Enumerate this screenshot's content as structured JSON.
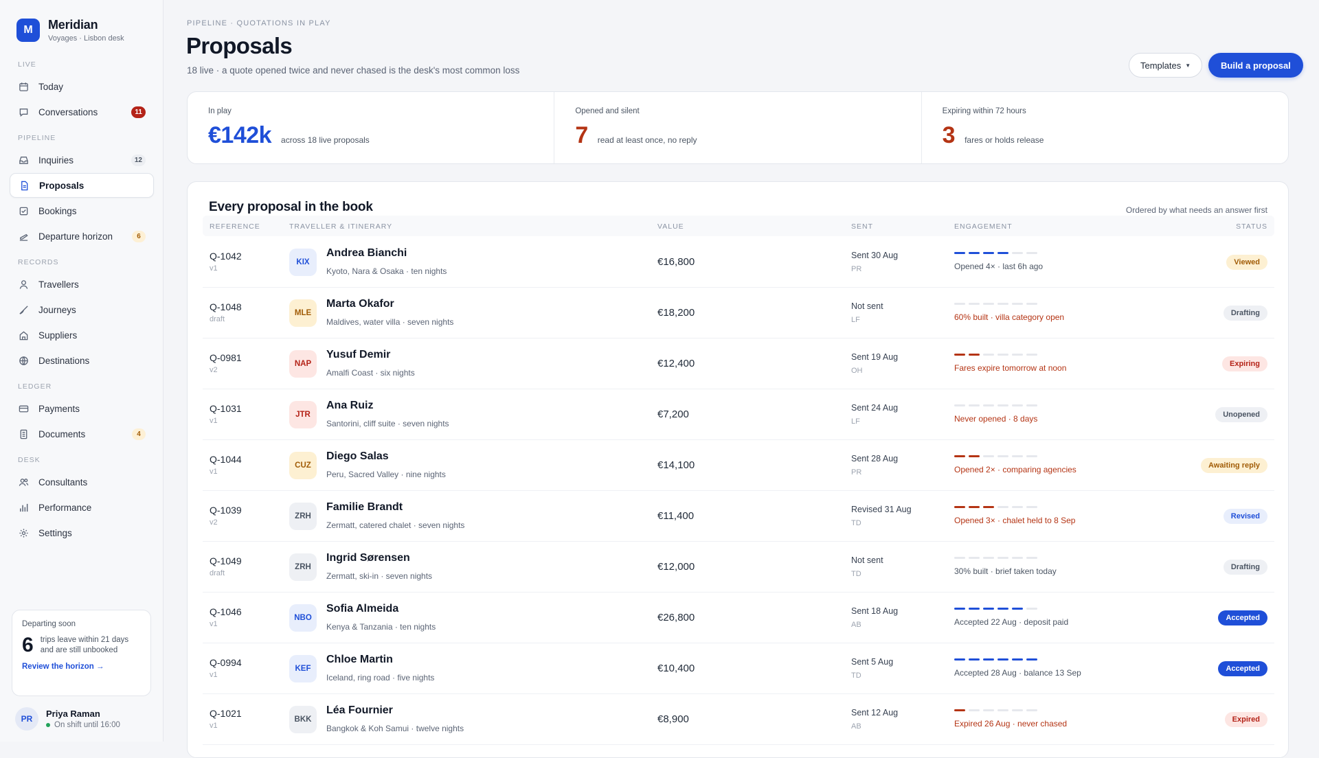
{
  "brand": {
    "logo": "M",
    "name": "Meridian",
    "sub": "Voyages · Lisbon desk"
  },
  "nav": {
    "sections": {
      "live": "LIVE",
      "pipeline": "PIPELINE",
      "records": "RECORDS",
      "ledger": "LEDGER",
      "desk": "DESK"
    },
    "items": {
      "today": {
        "label": "Today",
        "icon": "calendar-icon"
      },
      "conversations": {
        "label": "Conversations",
        "badge": "11",
        "icon": "chat-icon"
      },
      "inquiries": {
        "label": "Inquiries",
        "badge": "12",
        "icon": "inbox-icon"
      },
      "proposals": {
        "label": "Proposals",
        "icon": "document-icon"
      },
      "bookings": {
        "label": "Bookings",
        "icon": "check-square-icon"
      },
      "departure": {
        "label": "Departure horizon",
        "badge": "6",
        "icon": "plane-icon"
      },
      "travellers": {
        "label": "Travellers",
        "icon": "person-icon"
      },
      "journeys": {
        "label": "Journeys",
        "icon": "route-icon"
      },
      "suppliers": {
        "label": "Suppliers",
        "icon": "building-icon"
      },
      "destinations": {
        "label": "Destinations",
        "icon": "globe-icon"
      },
      "payments": {
        "label": "Payments",
        "icon": "card-icon"
      },
      "documents": {
        "label": "Documents",
        "badge": "4",
        "icon": "file-icon"
      },
      "consultants": {
        "label": "Consultants",
        "icon": "people-icon"
      },
      "performance": {
        "label": "Performance",
        "icon": "bar-chart-icon"
      },
      "settings": {
        "label": "Settings",
        "icon": "gear-icon"
      }
    }
  },
  "departing": {
    "title": "Departing soon",
    "count": "6",
    "text": "trips leave within 21 days and are still unbooked",
    "link": "Review the horizon →"
  },
  "user": {
    "initials": "PR",
    "name": "Priya Raman",
    "status": "On shift until 16:00"
  },
  "header": {
    "eyebrow": "PIPELINE · QUOTATIONS IN PLAY",
    "title": "Proposals",
    "subtitle": "18 live · a quote opened twice and never chased is the desk's most common loss",
    "templates_label": "Templates",
    "build_label": "Build a proposal"
  },
  "stats": [
    {
      "label": "In play",
      "value": "€142k",
      "desc": "across 18 live proposals"
    },
    {
      "label": "Opened and silent",
      "value": "7",
      "desc": "read at least once, no reply"
    },
    {
      "label": "Expiring within 72 hours",
      "value": "3",
      "desc": "fares or holds release"
    }
  ],
  "table": {
    "title": "Every proposal in the book",
    "note": "Ordered by what needs an answer first",
    "columns": {
      "reference": "REFERENCE",
      "traveller": "TRAVELLER & ITINERARY",
      "value": "VALUE",
      "sent": "SENT",
      "engagement": "ENGAGEMENT",
      "status": "STATUS"
    },
    "rows": [
      {
        "ref": "Q-1042",
        "ver": "v1",
        "code": "KIX",
        "name": "Andrea Bianchi",
        "itin": "Kyoto, Nara & Osaka · ten nights",
        "value": "€16,800",
        "sent": "Sent 30 Aug",
        "by": "PR",
        "eng_level": 4,
        "eng_text": "Opened 4× · last 6h ago",
        "status": "Viewed"
      },
      {
        "ref": "Q-1048",
        "ver": "draft",
        "code": "MLE",
        "name": "Marta Okafor",
        "itin": "Maldives, water villa · seven nights",
        "value": "€18,200",
        "sent": "Not sent",
        "by": "LF",
        "eng_level": 0,
        "eng_text": "60% built · villa category open",
        "status": "Drafting"
      },
      {
        "ref": "Q-0981",
        "ver": "v2",
        "code": "NAP",
        "name": "Yusuf Demir",
        "itin": "Amalfi Coast · six nights",
        "value": "€12,400",
        "sent": "Sent 19 Aug",
        "by": "OH",
        "eng_level": 2,
        "eng_text": "Fares expire tomorrow at noon",
        "status": "Expiring"
      },
      {
        "ref": "Q-1031",
        "ver": "v1",
        "code": "JTR",
        "name": "Ana Ruiz",
        "itin": "Santorini, cliff suite · seven nights",
        "value": "€7,200",
        "sent": "Sent 24 Aug",
        "by": "LF",
        "eng_level": 0,
        "eng_text": "Never opened · 8 days",
        "status": "Unopened"
      },
      {
        "ref": "Q-1044",
        "ver": "v1",
        "code": "CUZ",
        "name": "Diego Salas",
        "itin": "Peru, Sacred Valley · nine nights",
        "value": "€14,100",
        "sent": "Sent 28 Aug",
        "by": "PR",
        "eng_level": 2,
        "eng_text": "Opened 2× · comparing agencies",
        "status": "Awaiting reply"
      },
      {
        "ref": "Q-1039",
        "ver": "v2",
        "code": "ZRH",
        "name": "Familie Brandt",
        "itin": "Zermatt, catered chalet · seven nights",
        "value": "€11,400",
        "sent": "Revised 31 Aug",
        "by": "TD",
        "eng_level": 3,
        "eng_text": "Opened 3× · chalet held to 8 Sep",
        "status": "Revised"
      },
      {
        "ref": "Q-1049",
        "ver": "draft",
        "code": "ZRH",
        "name": "Ingrid Sørensen",
        "itin": "Zermatt, ski-in · seven nights",
        "value": "€12,000",
        "sent": "Not sent",
        "by": "TD",
        "eng_level": 0,
        "eng_text": "30% built · brief taken today",
        "status": "Drafting"
      },
      {
        "ref": "Q-1046",
        "ver": "v1",
        "code": "NBO",
        "name": "Sofia Almeida",
        "itin": "Kenya & Tanzania · ten nights",
        "value": "€26,800",
        "sent": "Sent 18 Aug",
        "by": "AB",
        "eng_level": 5,
        "eng_text": "Accepted 22 Aug · deposit paid",
        "status": "Accepted"
      },
      {
        "ref": "Q-0994",
        "ver": "v1",
        "code": "KEF",
        "name": "Chloe Martin",
        "itin": "Iceland, ring road · five nights",
        "value": "€10,400",
        "sent": "Sent 5 Aug",
        "by": "TD",
        "eng_level": 6,
        "eng_text": "Accepted 28 Aug · balance 13 Sep",
        "status": "Accepted"
      },
      {
        "ref": "Q-1021",
        "ver": "v1",
        "code": "BKK",
        "name": "Léa Fournier",
        "itin": "Bangkok & Koh Samui · twelve nights",
        "value": "€8,900",
        "sent": "Sent 12 Aug",
        "by": "AB",
        "eng_level": 1,
        "eng_text": "Expired 26 Aug · never chased",
        "status": "Expired"
      }
    ]
  },
  "colors": {
    "accent": "#1f4fd8",
    "warn": "#b43414"
  }
}
